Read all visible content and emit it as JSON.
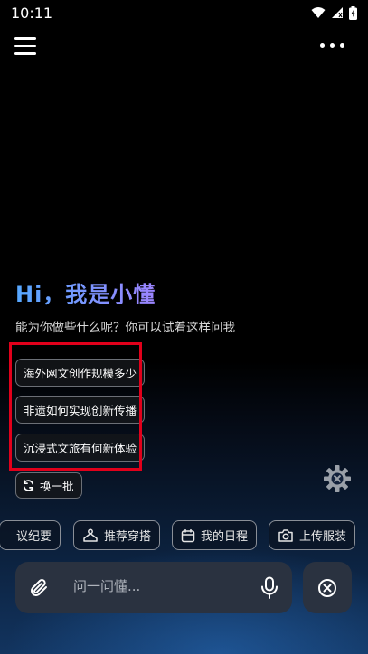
{
  "status_bar": {
    "time": "10:11"
  },
  "greeting": "Hi，我是小懂",
  "subtitle": "能为你做些什么呢？你可以试着这样问我",
  "suggestions": [
    "海外网文创作规模多少",
    "非遗如何实现创新传播",
    "沉浸式文旅有何新体验"
  ],
  "refresh_label": "换一批",
  "chips": [
    "议纪要",
    "推荐穿搭",
    "我的日程",
    "上传服装"
  ],
  "input": {
    "placeholder": "问一问懂..."
  },
  "colors": {
    "accent_start": "#56a8ff",
    "accent_end": "#9c84ff",
    "highlight": "#e1001b"
  }
}
